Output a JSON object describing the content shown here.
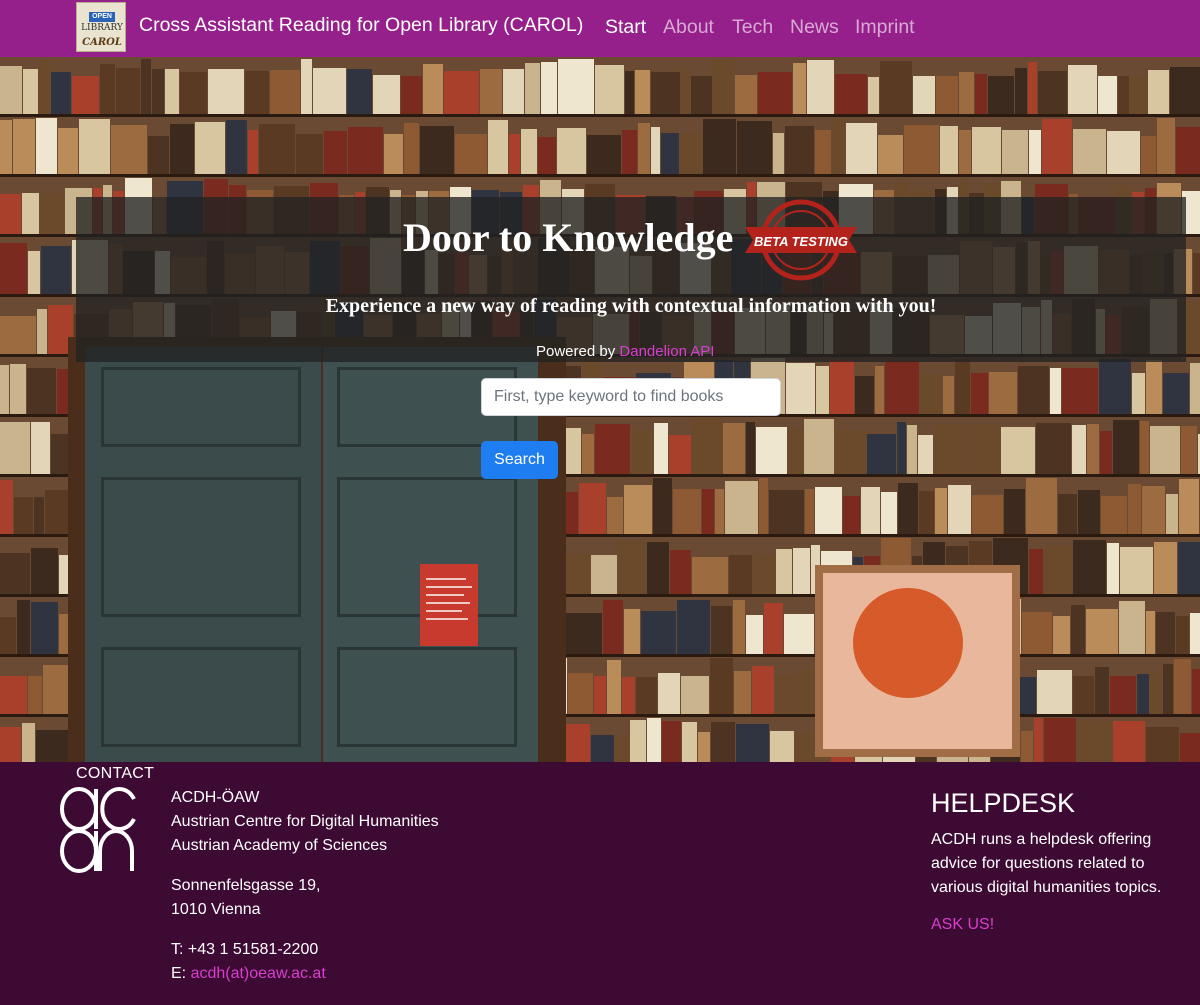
{
  "navbar": {
    "logo": {
      "top": "OPEN",
      "middle": "LIBRARY",
      "bottom": "CAROL"
    },
    "brand": "Cross Assistant Reading for Open Library (CAROL)",
    "links": [
      "Start",
      "About",
      "Tech",
      "News",
      "Imprint"
    ],
    "active_link": "Start",
    "bg_color": "#96208b"
  },
  "hero": {
    "title": "Door to Knowledge",
    "badge_text": "BETA TESTING",
    "subtitle": "Experience a new way of reading with contextual information with you!",
    "powered_prefix": "Powered by ",
    "powered_link": "Dandelion API",
    "search": {
      "placeholder": "First, type keyword to find books",
      "value": ""
    },
    "search_button": "Search"
  },
  "footer": {
    "contact_heading": "CONTACT",
    "org": [
      "ACDH-ÖAW",
      "Austrian Centre for Digital Humanities",
      "Austrian Academy of Sciences"
    ],
    "address": [
      "Sonnenfelsgasse 19,",
      "1010 Vienna"
    ],
    "phone": "T: +43 1 51581-2200",
    "email_prefix": "E: ",
    "email": "acdh(at)oeaw.ac.at",
    "helpdesk_title": "HELPDESK",
    "helpdesk_text": "ACDH runs a helpdesk offering advice for questions related to various digital humanities topics.",
    "ask_us": "ASK US!",
    "bg_color": "#3d0a33",
    "accent_color": "#d83fcf"
  }
}
